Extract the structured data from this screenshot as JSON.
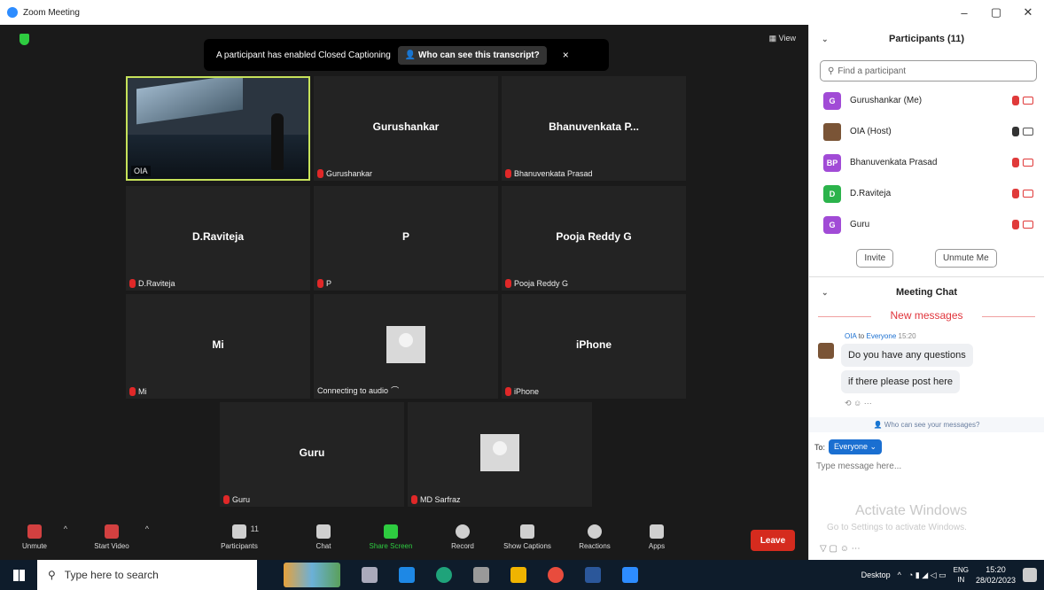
{
  "window": {
    "title": "Zoom Meeting",
    "controls": [
      "–",
      "▢",
      "✕"
    ]
  },
  "meeting": {
    "view_label": "View",
    "cc_banner": {
      "text": "A participant has enabled Closed Captioning",
      "link": "Who can see this transcript?",
      "close": "×"
    },
    "tiles": [
      {
        "name": "",
        "label": "OIA",
        "type": "video"
      },
      {
        "name": "Gurushankar",
        "label": "Gurushankar"
      },
      {
        "name": "Bhanuvenkata  P...",
        "label": "Bhanuvenkata Prasad"
      },
      {
        "name": "D.Raviteja",
        "label": "D.Raviteja"
      },
      {
        "name": "P",
        "label": "P"
      },
      {
        "name": "Pooja Reddy G",
        "label": "Pooja Reddy G"
      },
      {
        "name": "Mi",
        "label": "Mi"
      },
      {
        "name": "",
        "label": "Connecting to audio",
        "type": "avatar"
      },
      {
        "name": "iPhone",
        "label": "iPhone"
      },
      {
        "name": "Guru",
        "label": "Guru"
      },
      {
        "name": "",
        "label": "MD Sarfraz",
        "type": "avatar"
      }
    ]
  },
  "toolbar": {
    "unmute": "Unmute",
    "start_video": "Start Video",
    "participants": "Participants",
    "participants_count": "11",
    "chat": "Chat",
    "share_screen": "Share Screen",
    "record": "Record",
    "show_captions": "Show Captions",
    "reactions": "Reactions",
    "apps": "Apps",
    "leave": "Leave"
  },
  "participants_panel": {
    "title": "Participants (11)",
    "search_placeholder": "Find a participant",
    "list": [
      {
        "initial": "G",
        "name": "Gurushankar (Me)",
        "color": "#a14bd6"
      },
      {
        "initial": "",
        "name": "OIA (Host)",
        "color": "#7a5436"
      },
      {
        "initial": "BP",
        "name": "Bhanuvenkata Prasad",
        "color": "#a14bd6"
      },
      {
        "initial": "D",
        "name": "D.Raviteja",
        "color": "#2bb34b"
      },
      {
        "initial": "G",
        "name": "Guru",
        "color": "#a14bd6"
      }
    ],
    "invite": "Invite",
    "unmute_me": "Unmute Me"
  },
  "chat_panel": {
    "title": "Meeting Chat",
    "new_messages": "New messages",
    "sender": "OIA",
    "to_word": "to",
    "recipient": "Everyone",
    "time": "15:20",
    "messages": [
      "Do you have any questions",
      "if there please post here"
    ],
    "who_can_see": "Who can see your messages?",
    "to_label": "To:",
    "to_value": "Everyone",
    "type_placeholder": "Type message here...",
    "watermark_title": "Activate Windows",
    "watermark_sub": "Go to Settings to activate Windows."
  },
  "taskbar": {
    "search_placeholder": "Type here to search",
    "desktop": "Desktop",
    "lang1": "ENG",
    "lang2": "IN",
    "time": "15:20",
    "date": "28/02/2023"
  }
}
